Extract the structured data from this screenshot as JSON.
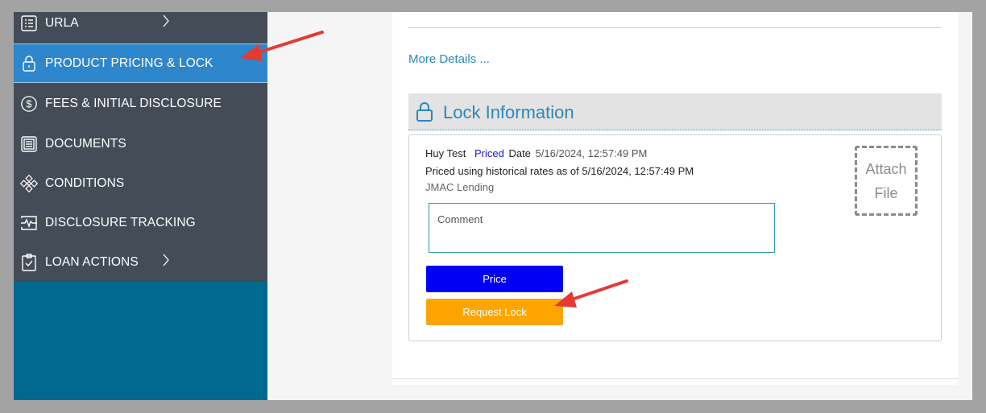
{
  "sidebar": {
    "items": [
      {
        "label": "URLA",
        "icon": "list-icon",
        "has_chevron": true
      },
      {
        "label": "PRODUCT PRICING & LOCK",
        "icon": "lock-icon",
        "active": true
      },
      {
        "label": "FEES & INITIAL DISCLOSURE",
        "icon": "dollar-circle-icon"
      },
      {
        "label": "DOCUMENTS",
        "icon": "documents-icon"
      },
      {
        "label": "CONDITIONS",
        "icon": "network-icon"
      },
      {
        "label": "DISCLOSURE TRACKING",
        "icon": "activity-icon"
      },
      {
        "label": "LOAN ACTIONS",
        "icon": "clipboard-check-icon",
        "has_chevron": true
      }
    ],
    "colors": {
      "nav_bg": "#434c57",
      "active_bg": "#2e86cc",
      "below_bg": "#00698f"
    }
  },
  "main": {
    "more_details": "More Details ...",
    "lock_section": {
      "title": "Lock Information",
      "user": "Huy Test",
      "status": "Priced",
      "date_label": "Date",
      "date_value": "5/16/2024, 12:57:49 PM",
      "priced_note": "Priced using historical rates as of 5/16/2024, 12:57:49 PM",
      "lender": "JMAC Lending",
      "comment_placeholder": "Comment",
      "attach_line1": "Attach",
      "attach_line2": "File",
      "price_button": "Price",
      "request_lock_button": "Request Lock"
    }
  },
  "colors": {
    "accent": "#2a88b8",
    "price_button": "#0000f5",
    "lock_button": "#ffa500",
    "annotation_arrow": "#e53935"
  }
}
